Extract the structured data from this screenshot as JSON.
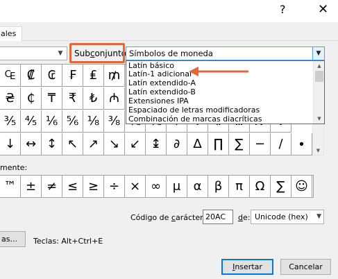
{
  "dialog": {
    "help_glyph": "?",
    "close_glyph": "✕"
  },
  "tab": {
    "label": "ales"
  },
  "subset": {
    "label_pre": "Sub",
    "label_key": "c",
    "label_post": "onjunto:",
    "value": "Símbolos de moneda",
    "options": [
      "Latín básico",
      "Latín-1 adicional",
      "Latín extendido-A",
      "Latín extendido-B",
      "Extensiones IPA",
      "Espaciado de letras modificadoras",
      "Combinación de marcas diacríticas"
    ],
    "highlighted_option_index": 1
  },
  "grid": {
    "rows": [
      [
        "₠",
        "₡",
        "₢",
        "₣",
        "₤",
        "₥"
      ],
      [
        "₴",
        "₵",
        "₸",
        "₹",
        "₺",
        "₼"
      ],
      [
        "⅗",
        "⅘",
        "⅙",
        "⅚",
        "⅛",
        "⅜",
        "⅝",
        "⅞",
        "⅟",
        "Ⅰ",
        "Ⅱ",
        "Ⅲ",
        "Ⅳ",
        "Ⅴ"
      ],
      [
        "↓",
        "↔",
        "↕",
        "↖",
        "↗",
        "↘",
        "↙",
        "↨",
        "∂",
        "∆",
        "∏",
        "∑",
        "−",
        "∕",
        "∙"
      ]
    ]
  },
  "recent": {
    "label": "mente:",
    "symbols": [
      "™",
      "±",
      "≠",
      "≤",
      "≥",
      "÷",
      "×",
      "∞",
      "μ",
      "α",
      "β",
      "π",
      "Ω",
      "∑",
      "☺"
    ]
  },
  "code": {
    "label_pre": "Código de ",
    "label_key": "c",
    "label_post": "arácter:",
    "value": "20AC",
    "from_key": "d",
    "from_post": "e:",
    "from_value": "Unicode (hex)"
  },
  "shortcut": {
    "button_label": "as...",
    "keys_label": "Teclas: Alt+Ctrl+E"
  },
  "buttons": {
    "insert_key": "I",
    "insert_rest": "nsertar",
    "cancel": "Cancelar"
  },
  "colors": {
    "highlight": "#e2683b",
    "focus_border": "#569de5",
    "default_button_border": "#0078d7"
  }
}
